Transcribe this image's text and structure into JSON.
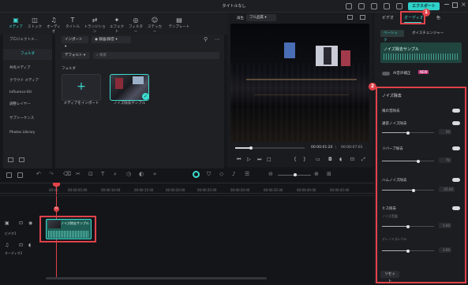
{
  "window": {
    "title": "タイトルなし",
    "export_label": "エクスポート"
  },
  "toolbar": {
    "items": [
      {
        "label": "メディア",
        "icon": "media-icon"
      },
      {
        "label": "ストック",
        "icon": "stock-icon"
      },
      {
        "label": "オーディオ",
        "icon": "audio-icon"
      },
      {
        "label": "タイトル",
        "icon": "title-icon"
      },
      {
        "label": "トランジション",
        "icon": "transition-icon"
      },
      {
        "label": "エフェクト",
        "icon": "effect-icon"
      },
      {
        "label": "フィルター",
        "icon": "filter-icon"
      },
      {
        "label": "ステッカー",
        "icon": "sticker-icon"
      },
      {
        "label": "テンプレート",
        "icon": "template-icon"
      }
    ]
  },
  "sidebar": {
    "items": [
      {
        "label": "プロジェクトメ..."
      },
      {
        "label": "フォルダ"
      },
      {
        "label": "共有メディア"
      },
      {
        "label": "クラウド メディア"
      },
      {
        "label": "Influence Kit"
      },
      {
        "label": "調整レイヤー"
      },
      {
        "label": "サブシーケンス"
      },
      {
        "label": "Photos Library"
      }
    ]
  },
  "media": {
    "import_label": "インポート",
    "record_label": "録画/録音",
    "default_label": "デフォルト",
    "search_placeholder": "検索",
    "folder_label": "フォルダ",
    "import_card_label": "メディアをインポート",
    "sample_card_label": "ノイズ除去サンプル"
  },
  "preview": {
    "tab_label": "再生",
    "quality": "フル品質",
    "time_current": "00:00:01:20",
    "time_separator": "|",
    "time_total": "00:00:07:01",
    "progress": 0.23
  },
  "right_panel": {
    "tabs": [
      "ビデオ",
      "オーディオ",
      "色"
    ],
    "subtabs": [
      "ベーシック",
      "ボイスチェンジャー"
    ],
    "clip_name": "ノイズ除去サンプル",
    "ai_label": "AI音声補正",
    "ai_badge": "NEW",
    "section_title": "ノイズ除去",
    "rows": [
      {
        "label": "風の音除去",
        "toggle": true
      },
      {
        "label": "通常ノイズ除去",
        "toggle": true,
        "value": "50",
        "level": 0.5
      },
      {
        "label": "リバーブ除去",
        "toggle": true,
        "value": "70",
        "level": 0.7
      },
      {
        "label": "ハムノイズ除去",
        "toggle": true,
        "value": "-25.00",
        "level": 0.6
      },
      {
        "label": "ヒス除去",
        "toggle": true,
        "sub": "ノイズ音量",
        "value": "5.00",
        "level": 0.5
      },
      {
        "label": "",
        "toggle": false,
        "sub": "ディノイズレベル",
        "value": "3.00",
        "level": 0.5
      }
    ],
    "reset_label": "リセット",
    "callout_1": "1",
    "callout_2": "2"
  },
  "timeline": {
    "ruler": [
      "00:00",
      "00:00:05:00",
      "00:00:10:00",
      "00:00:15:00",
      "00:00:20:00",
      "00:00:25:00",
      "00:00:30:00",
      "00:00:35:00",
      "00:00:40:00",
      "00:00:45:00"
    ],
    "video_track": "ビデオ1",
    "audio_track": "オーディオ1",
    "clip_label": "ノイズ除去サンプル"
  }
}
